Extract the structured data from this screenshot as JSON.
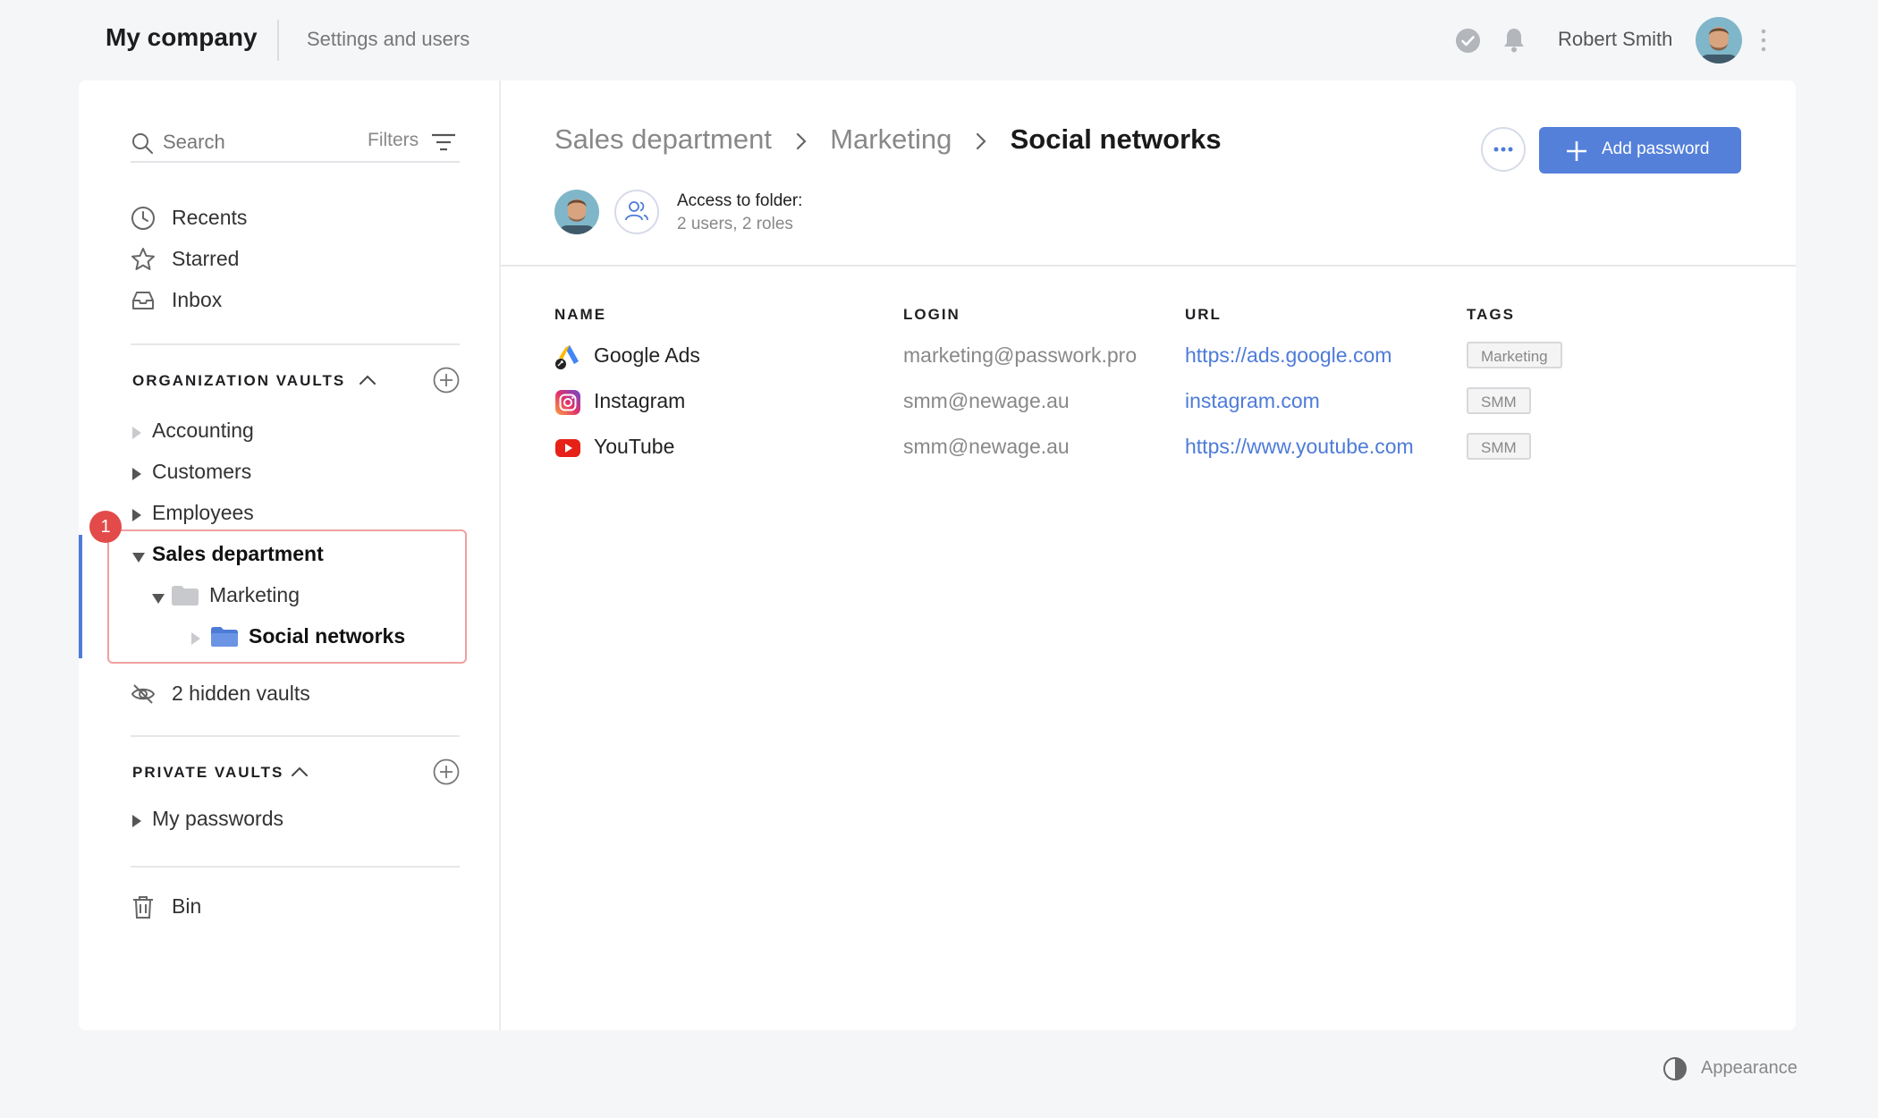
{
  "header": {
    "company": "My company",
    "section": "Settings and users",
    "user_name": "Robert Smith"
  },
  "sidebar": {
    "search_placeholder": "Search",
    "filters_label": "Filters",
    "nav": [
      {
        "label": "Recents",
        "icon": "clock-icon"
      },
      {
        "label": "Starred",
        "icon": "star-icon"
      },
      {
        "label": "Inbox",
        "icon": "inbox-icon"
      }
    ],
    "org_vaults": {
      "title": "ORGANIZATION VAULTS",
      "items": [
        "Accounting",
        "Customers",
        "Employees"
      ],
      "active_vault": "Sales department",
      "active_folder": "Marketing",
      "active_subfolder": "Social networks",
      "badge": "1"
    },
    "hidden_vaults": "2 hidden vaults",
    "private_vaults": {
      "title": "PRIVATE VAULTS",
      "items": [
        "My passwords"
      ]
    },
    "bin": "Bin"
  },
  "content": {
    "breadcrumb": [
      "Sales department",
      "Marketing"
    ],
    "breadcrumb_current": "Social networks",
    "add_button": "Add password",
    "access_title": "Access to folder:",
    "access_sub": "2 users, 2 roles",
    "columns": {
      "name": "NAME",
      "login": "LOGIN",
      "url": "URL",
      "tags": "TAGS"
    },
    "rows": [
      {
        "name": "Google Ads",
        "login": "marketing@passwork.pro",
        "url": "https://ads.google.com",
        "tag": "Marketing",
        "icon": "google-ads-icon"
      },
      {
        "name": "Instagram",
        "login": "smm@newage.au",
        "url": "instagram.com",
        "tag": "SMM",
        "icon": "instagram-icon"
      },
      {
        "name": "YouTube",
        "login": "smm@newage.au",
        "url": "https://www.youtube.com",
        "tag": "SMM",
        "icon": "youtube-icon"
      }
    ]
  },
  "footer": {
    "appearance": "Appearance"
  },
  "colors": {
    "accent": "#5480da",
    "badge": "#e34a4a",
    "highlight_border": "#f0a0a0"
  }
}
